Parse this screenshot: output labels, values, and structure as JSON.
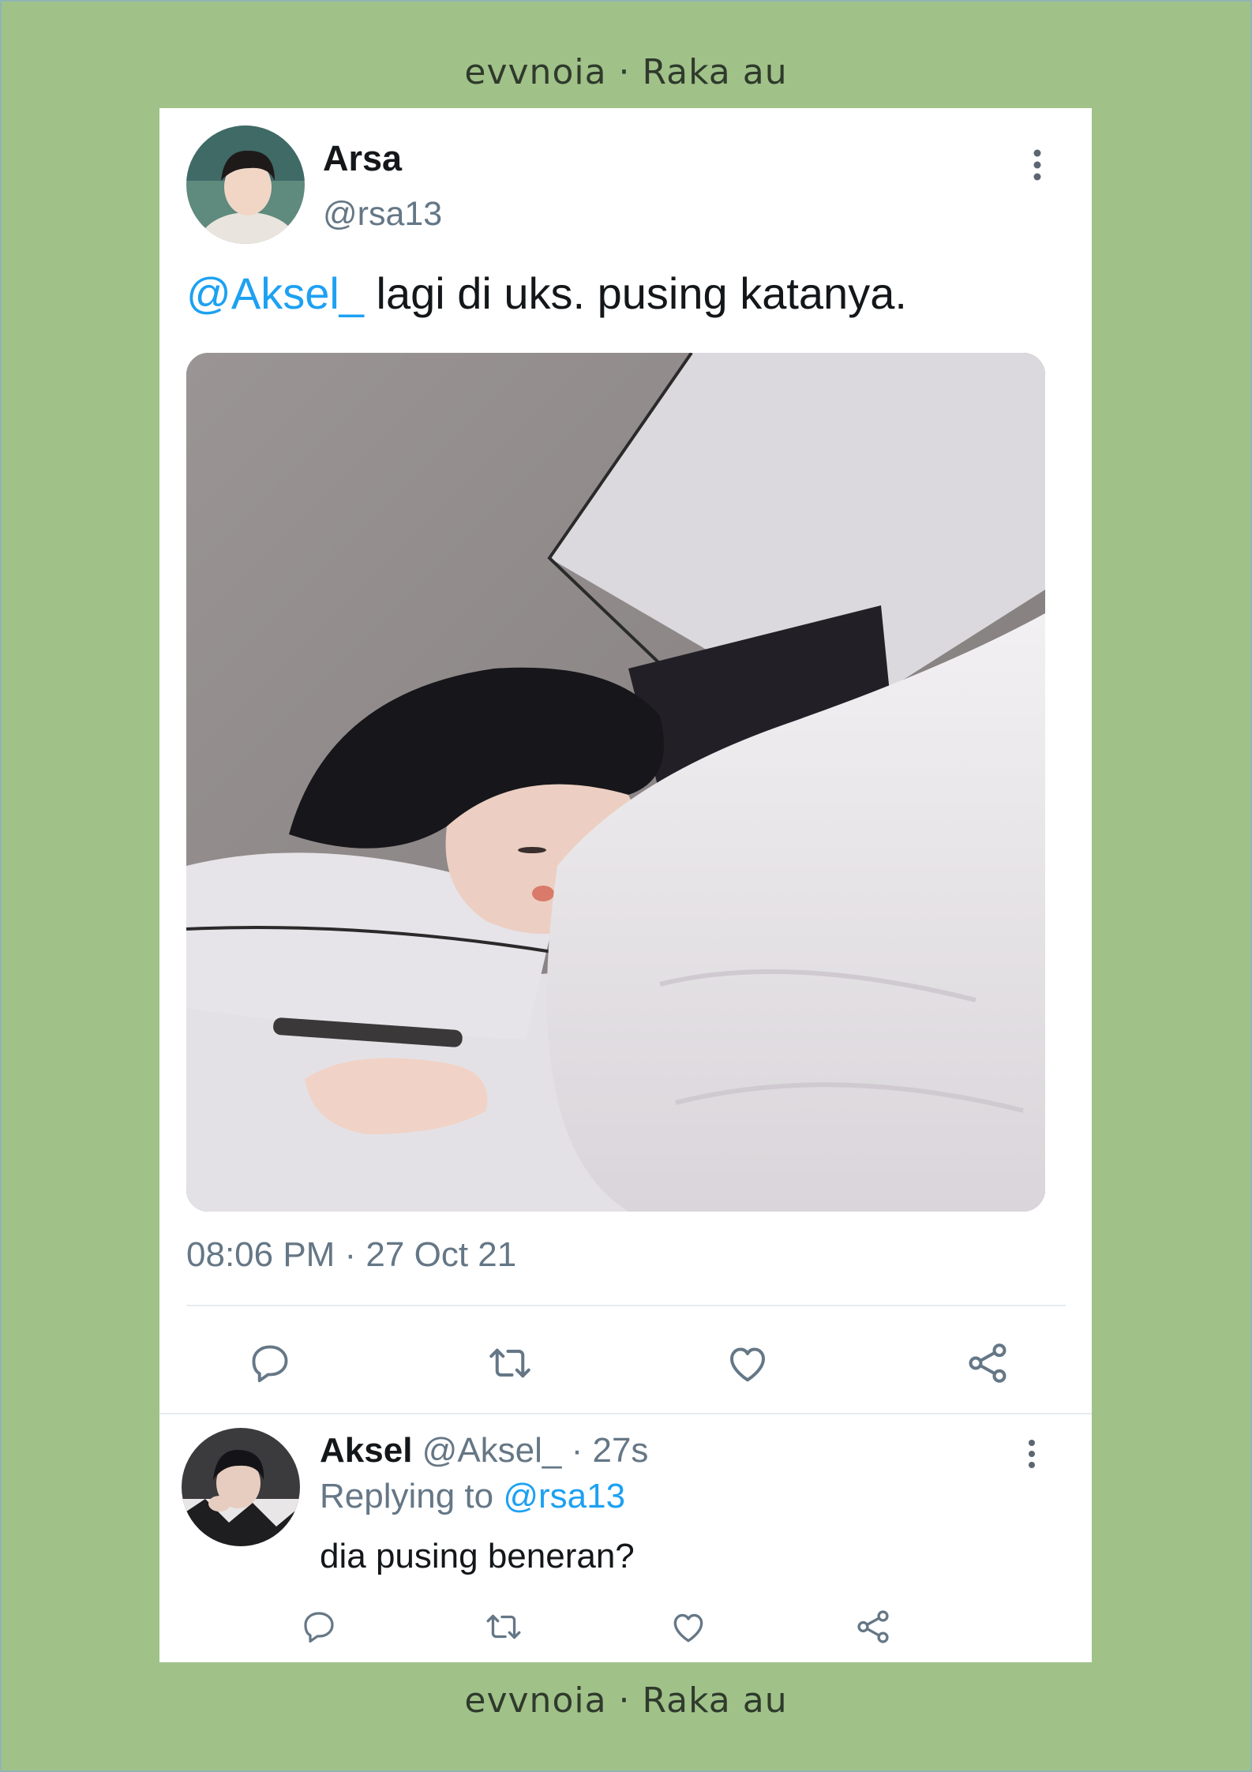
{
  "watermark": {
    "top": "evvnoia · Raka au",
    "bottom": "evvnoia · Raka au"
  },
  "tweet": {
    "author_name": "Arsa",
    "author_handle": "@rsa13",
    "mention": "@Aksel_",
    "text": " lagi di uks. pusing katanya.",
    "timestamp": "08:06 PM · 27 Oct 21",
    "actions": [
      "reply-icon",
      "retweet-icon",
      "like-icon",
      "share-icon"
    ]
  },
  "reply": {
    "author_name": "Aksel",
    "meta": " @Aksel_ · 27s",
    "replying_prefix": "Replying to ",
    "replying_handle": "@rsa13",
    "text": "dia pusing beneran?",
    "actions": [
      "reply-icon",
      "retweet-icon",
      "like-icon",
      "share-icon"
    ]
  },
  "colors": {
    "background": "#a0c289",
    "card": "#ffffff",
    "link": "#1da1f2",
    "muted": "#657786",
    "text": "#14171a"
  }
}
